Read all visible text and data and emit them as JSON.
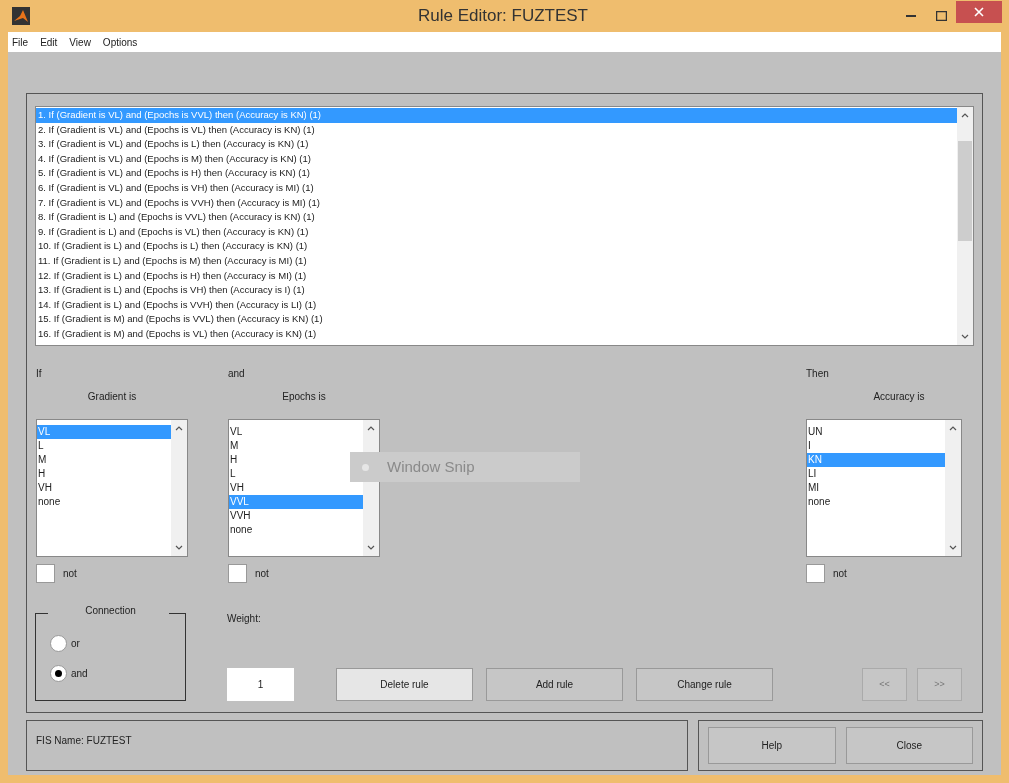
{
  "window": {
    "title": "Rule Editor: FUZTEST"
  },
  "menu": [
    "File",
    "Edit",
    "View",
    "Options"
  ],
  "rules": [
    {
      "text": "1. If (Gradient is VL) and (Epochs is VVL) then (Accuracy is KN) (1)",
      "selected": true
    },
    {
      "text": "2. If (Gradient is VL) and (Epochs is VL) then (Accuracy is KN) (1)",
      "selected": false
    },
    {
      "text": "3. If (Gradient is VL) and (Epochs is L) then (Accuracy is KN) (1)",
      "selected": false
    },
    {
      "text": "4. If (Gradient is VL) and (Epochs is M) then (Accuracy is KN) (1)",
      "selected": false
    },
    {
      "text": "5. If (Gradient is VL) and (Epochs is H) then (Accuracy is KN) (1)",
      "selected": false
    },
    {
      "text": "6. If (Gradient is VL) and (Epochs is VH) then (Accuracy is MI) (1)",
      "selected": false
    },
    {
      "text": "7. If (Gradient is VL) and (Epochs is VVH) then (Accuracy is MI) (1)",
      "selected": false
    },
    {
      "text": "8. If (Gradient is L) and (Epochs is VVL) then (Accuracy is KN) (1)",
      "selected": false
    },
    {
      "text": "9. If (Gradient is L) and (Epochs is VL) then (Accuracy is KN) (1)",
      "selected": false
    },
    {
      "text": "10. If (Gradient is L) and (Epochs is L) then (Accuracy is KN) (1)",
      "selected": false
    },
    {
      "text": "11. If (Gradient is L) and (Epochs is M) then (Accuracy is MI) (1)",
      "selected": false
    },
    {
      "text": "12. If (Gradient is L) and (Epochs is H) then (Accuracy is MI) (1)",
      "selected": false
    },
    {
      "text": "13. If (Gradient is L) and (Epochs is VH) then (Accuracy is I) (1)",
      "selected": false
    },
    {
      "text": "14. If (Gradient is L) and (Epochs is VVH) then (Accuracy is LI) (1)",
      "selected": false
    },
    {
      "text": "15. If (Gradient is M) and (Epochs is VVL) then (Accuracy is KN) (1)",
      "selected": false
    },
    {
      "text": "16. If (Gradient is M) and (Epochs is VL) then (Accuracy is KN) (1)",
      "selected": false
    }
  ],
  "inputs": [
    {
      "connector": "If",
      "label": "Gradient is",
      "not_label": "not",
      "not_checked": false,
      "items": [
        {
          "text": "VL",
          "selected": true
        },
        {
          "text": "L",
          "selected": false
        },
        {
          "text": "M",
          "selected": false
        },
        {
          "text": "H",
          "selected": false
        },
        {
          "text": "VH",
          "selected": false
        },
        {
          "text": "none",
          "selected": false
        }
      ]
    },
    {
      "connector": "and",
      "label": "Epochs is",
      "not_label": "not",
      "not_checked": false,
      "items": [
        {
          "text": "VL",
          "selected": false
        },
        {
          "text": "M",
          "selected": false
        },
        {
          "text": "H",
          "selected": false
        },
        {
          "text": "L",
          "selected": false
        },
        {
          "text": "VH",
          "selected": false
        },
        {
          "text": "VVL",
          "selected": true
        },
        {
          "text": "VVH",
          "selected": false
        },
        {
          "text": "none",
          "selected": false
        }
      ]
    }
  ],
  "output": {
    "connector": "Then",
    "label": "Accuracy is",
    "not_label": "not",
    "not_checked": false,
    "items": [
      {
        "text": "UN",
        "selected": false
      },
      {
        "text": "I",
        "selected": false
      },
      {
        "text": "KN",
        "selected": true
      },
      {
        "text": "LI",
        "selected": false
      },
      {
        "text": "MI",
        "selected": false
      },
      {
        "text": "none",
        "selected": false
      }
    ]
  },
  "connection": {
    "title": "Connection",
    "options": [
      {
        "label": "or",
        "selected": false
      },
      {
        "label": "and",
        "selected": true
      }
    ]
  },
  "weight": {
    "label": "Weight:",
    "value": "1"
  },
  "rule_buttons": [
    {
      "label": "Delete rule",
      "disabled": false,
      "focused": true
    },
    {
      "label": "Add rule",
      "disabled": false,
      "focused": false
    },
    {
      "label": "Change rule",
      "disabled": false,
      "focused": false
    }
  ],
  "nav_buttons": [
    {
      "label": "<<",
      "disabled": true
    },
    {
      "label": ">>",
      "disabled": true
    }
  ],
  "status": "FIS Name: FUZTEST",
  "footer_buttons": [
    "Help",
    "Close"
  ],
  "snip_tooltip": "Window Snip"
}
